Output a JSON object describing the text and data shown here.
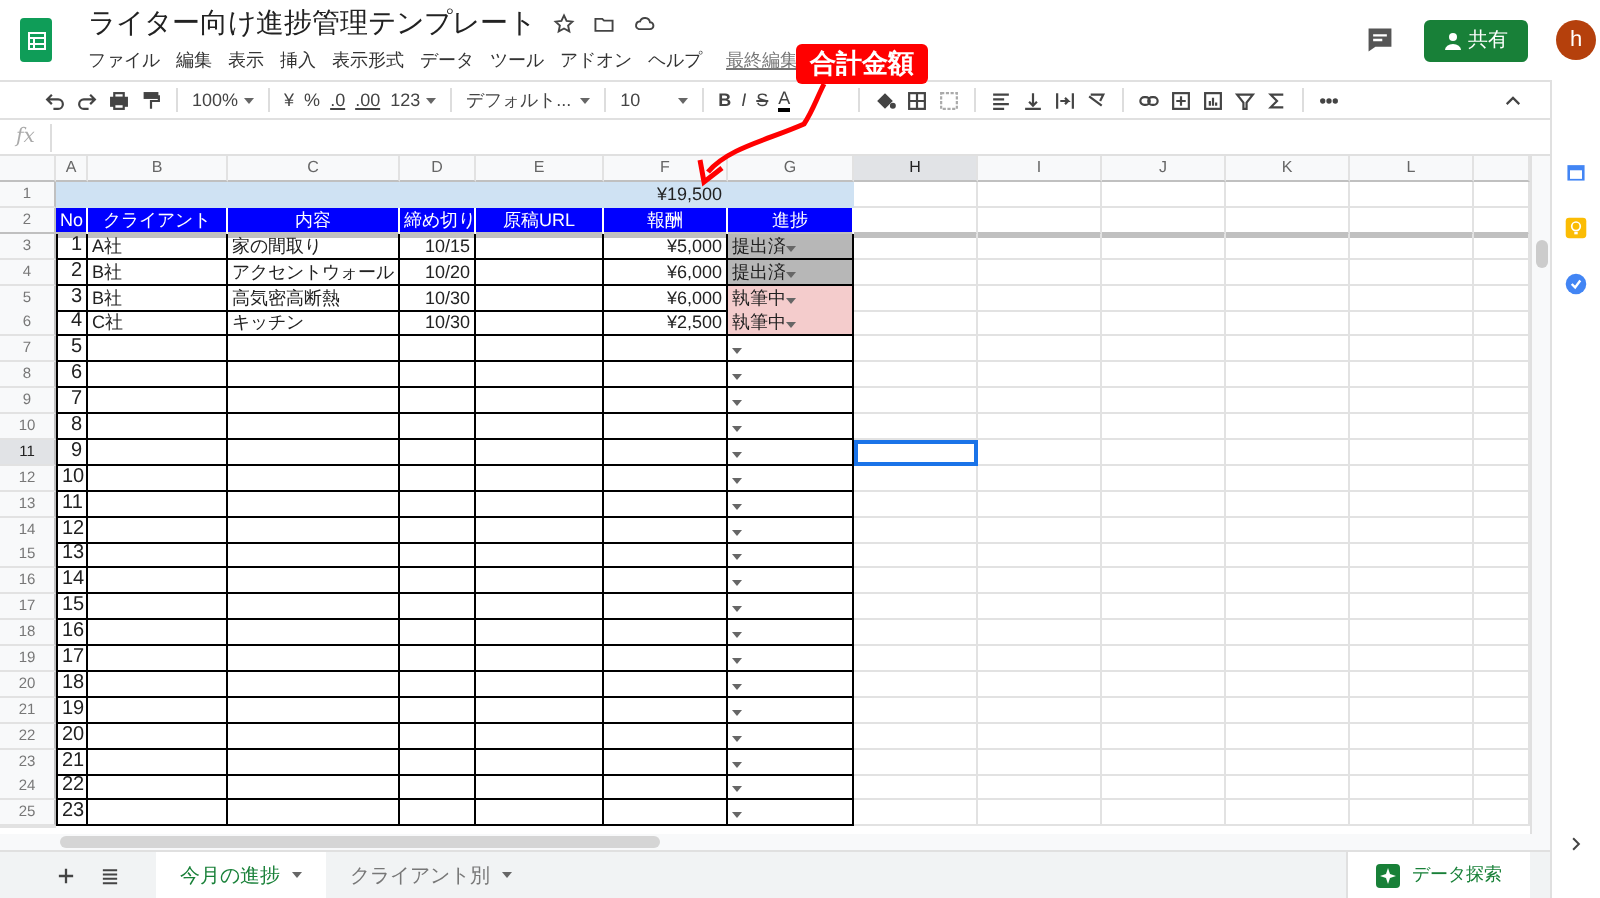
{
  "document": {
    "title": "ライター向け進捗管理テンプレート",
    "menu": [
      "ファイル",
      "編集",
      "表示",
      "挿入",
      "表示形式",
      "データ",
      "ツール",
      "アドオン",
      "ヘルプ"
    ],
    "last_edit": "最終編集"
  },
  "header_actions": {
    "share": "共有",
    "avatar": "h"
  },
  "toolbar": {
    "zoom": "100%",
    "currency": "¥",
    "percent": "%",
    "decimal_decrease": ".0",
    "decimal_increase": ".00",
    "number_format": "123",
    "font": "デフォルト...",
    "font_size": "10",
    "bold": "B",
    "italic": "I",
    "strikethrough": "S",
    "text_color": "A"
  },
  "formula_bar": {
    "label": "fx"
  },
  "columns": [
    {
      "label": "A",
      "selected": false
    },
    {
      "label": "B",
      "selected": false
    },
    {
      "label": "C",
      "selected": false
    },
    {
      "label": "D",
      "selected": false
    },
    {
      "label": "E",
      "selected": false
    },
    {
      "label": "F",
      "selected": false
    },
    {
      "label": "G",
      "selected": false
    },
    {
      "label": "H",
      "selected": true
    },
    {
      "label": "I",
      "selected": false
    },
    {
      "label": "J",
      "selected": false
    },
    {
      "label": "K",
      "selected": false
    },
    {
      "label": "L",
      "selected": false
    }
  ],
  "row_numbers": [
    {
      "label": "1",
      "selected": false
    },
    {
      "label": "2",
      "selected": false
    },
    {
      "label": "3",
      "selected": false
    },
    {
      "label": "4",
      "selected": false
    },
    {
      "label": "5",
      "selected": false
    },
    {
      "label": "6",
      "selected": false
    },
    {
      "label": "7",
      "selected": false
    },
    {
      "label": "8",
      "selected": false
    },
    {
      "label": "9",
      "selected": false
    },
    {
      "label": "10",
      "selected": false
    },
    {
      "label": "11",
      "selected": true
    },
    {
      "label": "12",
      "selected": false
    },
    {
      "label": "13",
      "selected": false
    },
    {
      "label": "14",
      "selected": false
    },
    {
      "label": "15",
      "selected": false
    },
    {
      "label": "16",
      "selected": false
    },
    {
      "label": "17",
      "selected": false
    },
    {
      "label": "18",
      "selected": false
    },
    {
      "label": "19",
      "selected": false
    },
    {
      "label": "20",
      "selected": false
    },
    {
      "label": "21",
      "selected": false
    },
    {
      "label": "22",
      "selected": false
    },
    {
      "label": "23",
      "selected": false
    },
    {
      "label": "24",
      "selected": false
    },
    {
      "label": "25",
      "selected": false
    }
  ],
  "sheet": {
    "total": "¥19,500",
    "headers": [
      "No",
      "クライアント",
      "内容",
      "締め切り",
      "原稿URL",
      "報酬",
      "進捗"
    ],
    "rows": [
      {
        "no": "1",
        "client": "A社",
        "content": "家の間取り",
        "deadline": "10/15",
        "fee": "¥5,000",
        "status": "提出済",
        "color": "#b7b7b7"
      },
      {
        "no": "2",
        "client": "B社",
        "content": "アクセントウォール",
        "deadline": "10/20",
        "fee": "¥6,000",
        "status": "提出済",
        "color": "#b7b7b7"
      },
      {
        "no": "3",
        "client": "B社",
        "content": "高気密高断熱",
        "deadline": "10/30",
        "fee": "¥6,000",
        "status": "執筆中",
        "color": "#f4cccc"
      },
      {
        "no": "4",
        "client": "C社",
        "content": "キッチン",
        "deadline": "10/30",
        "fee": "¥2,500",
        "status": "執筆中",
        "color": "#f4cccc"
      },
      {
        "no": "5"
      },
      {
        "no": "6"
      },
      {
        "no": "7"
      },
      {
        "no": "8"
      },
      {
        "no": "9"
      },
      {
        "no": "10"
      },
      {
        "no": "11"
      },
      {
        "no": "12"
      },
      {
        "no": "13"
      },
      {
        "no": "14"
      },
      {
        "no": "15"
      },
      {
        "no": "16"
      },
      {
        "no": "17"
      },
      {
        "no": "18"
      },
      {
        "no": "19"
      },
      {
        "no": "20"
      },
      {
        "no": "21"
      },
      {
        "no": "22"
      },
      {
        "no": "23"
      }
    ]
  },
  "annotation": {
    "label": "合計金額"
  },
  "sheet_tabs": [
    {
      "label": "今月の進捗",
      "selected": true
    },
    {
      "label": "クライアント別",
      "selected": false
    }
  ],
  "explore": "データ探索"
}
